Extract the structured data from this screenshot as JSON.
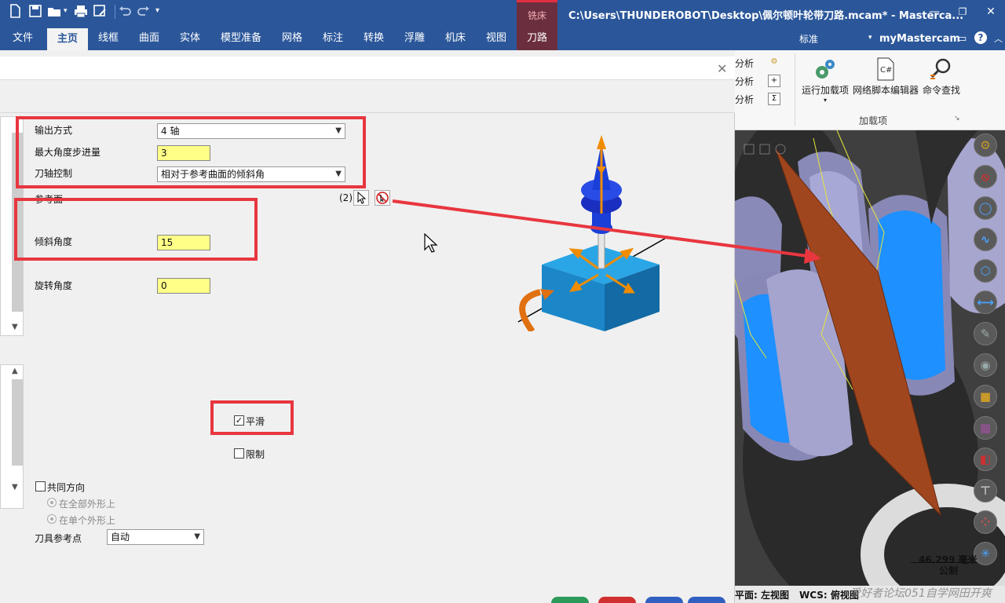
{
  "titlebar": {
    "window_title": "C:\\Users\\THUNDEROBOT\\Desktop\\佩尔顿叶轮带刀路.mcam* - Masterca...",
    "context_tab": "铣床",
    "quick_access": [
      "new-file-icon",
      "save-icon",
      "open-icon",
      "print-icon",
      "save-as-icon",
      "undo-icon",
      "redo-icon",
      "customize-icon"
    ]
  },
  "ribbon": {
    "tabs": [
      "文件",
      "主页",
      "线框",
      "曲面",
      "实体",
      "模型准备",
      "网格",
      "标注",
      "转换",
      "浮雕",
      "机床",
      "视图",
      "刀路"
    ],
    "active_tab": "主页",
    "standard_label": "标准",
    "account_label": "myMastercam",
    "analysis_items": [
      "分析",
      "分析",
      "分析"
    ],
    "buttons": {
      "run_addin": "运行加载项",
      "net_script_editor": "网络脚本编辑器",
      "command_finder": "命令查找"
    },
    "group_label": "加载项",
    "script_icon_text": "C#"
  },
  "dialog": {
    "output_method_label": "输出方式",
    "output_method_value": "4 轴",
    "max_angle_step_label": "最大角度步进量",
    "max_angle_step_value": "3",
    "tool_axis_control_label": "刀轴控制",
    "tool_axis_control_value": "相对于参考曲面的倾斜角",
    "reference_surface_label": "参考面",
    "reference_surface_count": "(2)",
    "tilt_angle_label": "倾斜角度",
    "tilt_angle_value": "15",
    "rotation_angle_label": "旋转角度",
    "rotation_angle_value": "0",
    "smooth_label": "平滑",
    "smooth_checked": true,
    "limit_label": "限制",
    "limit_checked": false,
    "common_direction_label": "共同方向",
    "common_direction_checked": false,
    "radio_all_contours": "在全部外形上",
    "radio_single_contour": "在单个外形上",
    "tool_ref_point_label": "刀具参考点",
    "tool_ref_point_value": "自动"
  },
  "viewport": {
    "scale_value": "46.299 毫米",
    "scale_unit": "公制",
    "status_plane": "平面: 左视图",
    "status_wcs": "WCS: 俯视图",
    "watermark": "爱好者论坛051自学网田开爽"
  },
  "colors": {
    "title_blue": "#2b579a",
    "highlight_red": "#e8363f",
    "field_yellow": "#ffff88",
    "toolpath_tab": "#6b2e3e",
    "tool_blue": "#1a3fd8",
    "block_blue": "#1b87c9",
    "arrow_orange": "#f08c00"
  }
}
